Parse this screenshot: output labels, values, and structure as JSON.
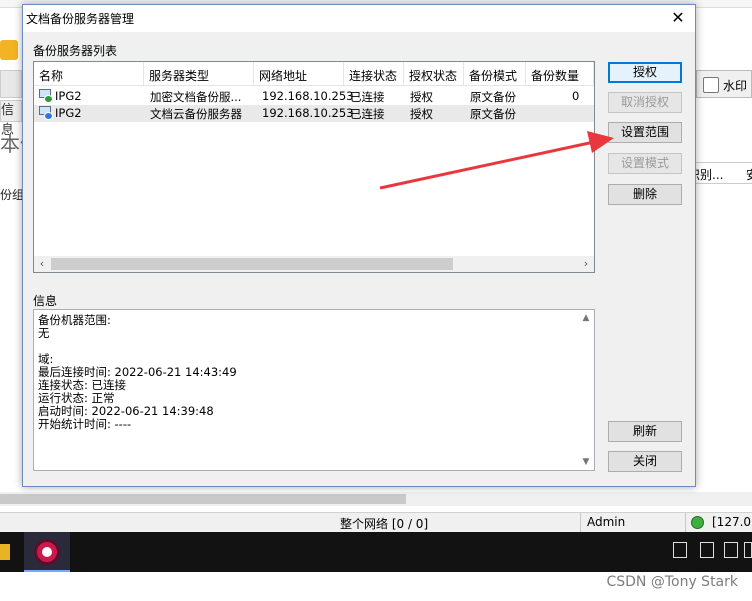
{
  "background": {
    "left_chip": "信息",
    "left_big_text": "本信",
    "left_group": "份组",
    "watermark_tab": "水印",
    "col_headers": [
      "识别...",
      "安"
    ],
    "status_network": "整个网络 [0 / 0]",
    "status_user": "Admin",
    "status_server": "[127.0."
  },
  "dialog": {
    "title": "文档备份服务器管理",
    "list_label": "备份服务器列表",
    "columns": [
      "名称",
      "服务器类型",
      "网络地址",
      "连接状态",
      "授权状态",
      "备份模式",
      "备份数量"
    ],
    "rows": [
      {
        "name": "IPG2",
        "type": "加密文档备份服...",
        "address": "192.168.10.253",
        "connection": "已连接",
        "auth": "授权",
        "mode": "原文备份",
        "count": "0",
        "selected": false
      },
      {
        "name": "IPG2",
        "type": "文档云备份服务器",
        "address": "192.168.10.253",
        "connection": "已连接",
        "auth": "授权",
        "mode": "原文备份",
        "count": "",
        "selected": true
      }
    ],
    "info_label": "信息",
    "info_lines": [
      "备份机器范围:",
      "无",
      "",
      "域:",
      "最后连接时间: 2022-06-21 14:43:49",
      "连接状态: 已连接",
      "运行状态: 正常",
      "启动时间: 2022-06-21 14:39:48",
      "开始统计时间: ----"
    ],
    "buttons": {
      "authorize": "授权",
      "revoke": "取消授权",
      "set_scope": "设置范围",
      "set_mode": "设置模式",
      "delete": "删除",
      "refresh": "刷新",
      "close": "关闭"
    },
    "close_glyph": "✕"
  },
  "watermark": "CSDN @Tony Stark",
  "colors": {
    "arrow": "#e8383d",
    "accent": "#0078d7",
    "taskbar": "#121212"
  }
}
